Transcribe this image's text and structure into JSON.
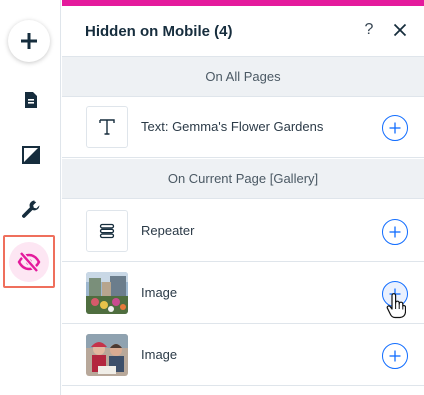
{
  "toolbar": {
    "items": [
      {
        "name": "add-elements",
        "icon": "plus-icon"
      },
      {
        "name": "pages",
        "icon": "page-icon"
      },
      {
        "name": "design",
        "icon": "background-icon"
      },
      {
        "name": "tools",
        "icon": "wrench-icon"
      },
      {
        "name": "hidden-on-mobile",
        "icon": "eye-hidden-icon",
        "active": true
      }
    ]
  },
  "panel": {
    "title": "Hidden on Mobile (4)",
    "help_label": "?",
    "accent_color": "#e41a9c",
    "sections": [
      {
        "header": "On All Pages",
        "items": [
          {
            "label": "Text: Gemma's Flower Gardens",
            "icon": "text-icon"
          }
        ]
      },
      {
        "header": "On Current Page [Gallery]",
        "items": [
          {
            "label": "Repeater",
            "icon": "repeater-icon"
          },
          {
            "label": "Image",
            "icon": "image-thumbnail-flowers"
          },
          {
            "label": "Image",
            "icon": "image-thumbnail-people"
          }
        ]
      }
    ]
  },
  "colors": {
    "button_blue": "#116dff",
    "active_highlight": "#ef6f5c",
    "active_icon": "#e41a9c",
    "section_bg": "#eef1f4"
  }
}
